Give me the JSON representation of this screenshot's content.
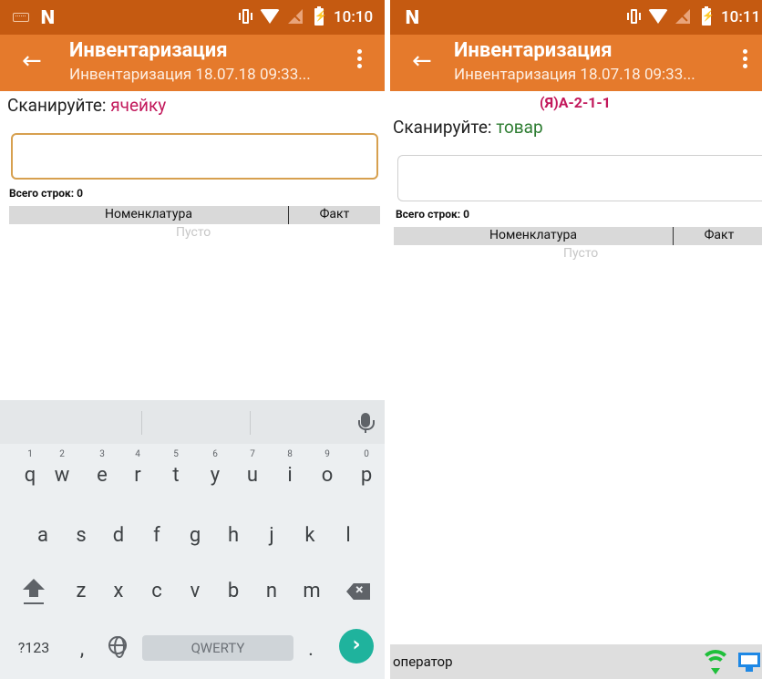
{
  "left": {
    "statusbar": {
      "time": "10:10"
    },
    "appbar": {
      "title": "Инвентаризация",
      "subtitle": "Инвентаризация 18.07.18 09:33..."
    },
    "scan": {
      "prefix": "Сканируйте: ",
      "target": "ячейку"
    },
    "input": {
      "value": ""
    },
    "rows_count": "Всего строк: 0",
    "table": {
      "col_name": "Номенклатура",
      "col_fact": "Факт",
      "empty": "Пусто"
    },
    "keyboard": {
      "row1": [
        {
          "key": "q",
          "num": "1"
        },
        {
          "key": "w",
          "num": "2"
        },
        {
          "key": "e",
          "num": "3"
        },
        {
          "key": "r",
          "num": "4"
        },
        {
          "key": "t",
          "num": "5"
        },
        {
          "key": "y",
          "num": "6"
        },
        {
          "key": "u",
          "num": "7"
        },
        {
          "key": "i",
          "num": "8"
        },
        {
          "key": "o",
          "num": "9"
        },
        {
          "key": "p",
          "num": "0"
        }
      ],
      "row2": [
        "a",
        "s",
        "d",
        "f",
        "g",
        "h",
        "j",
        "k",
        "l"
      ],
      "row3": [
        "z",
        "x",
        "c",
        "v",
        "b",
        "n",
        "m"
      ],
      "symbols_label": "?123",
      "comma": ",",
      "space_label": "QWERTY",
      "period": ".",
      "go_symbol": "›"
    }
  },
  "right": {
    "statusbar": {
      "time": "10:11"
    },
    "appbar": {
      "title": "Инвентаризация",
      "subtitle": "Инвентаризация 18.07.18 09:33..."
    },
    "cell_code": "(Я)А-2-1-1",
    "scan": {
      "prefix": "Сканируйте: ",
      "target": "товар"
    },
    "input": {
      "value": ""
    },
    "rows_count": "Всего строк: 0",
    "table": {
      "col_name": "Номенклатура",
      "col_fact": "Факт",
      "empty": "Пусто"
    },
    "bottom": {
      "operator": "оператор"
    }
  },
  "colors": {
    "statusbar": "#c55a11",
    "appbar": "#e57a2c",
    "scan_cell_target": "#c2185b",
    "scan_item_target": "#2e7d32",
    "input_focus_border": "#d7a04f",
    "go_button": "#1fb39d",
    "wifi_ok": "#1fbf3a",
    "monitor": "#1e88e5"
  }
}
